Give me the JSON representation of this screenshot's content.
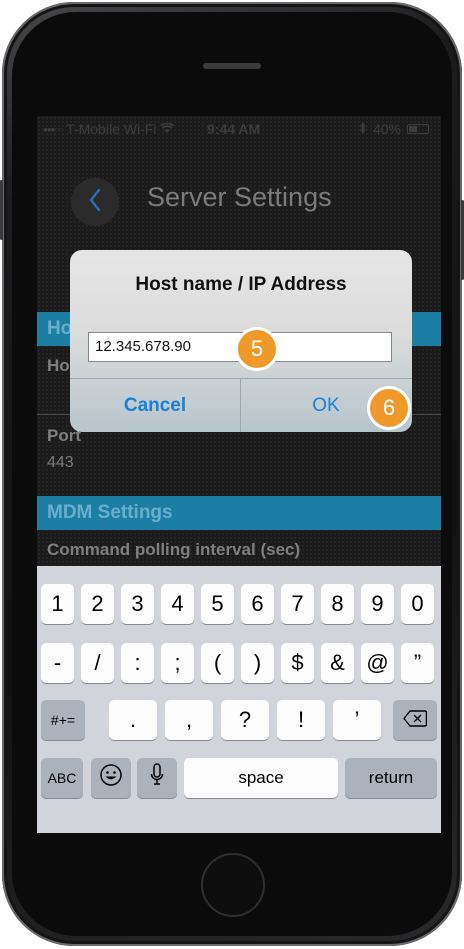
{
  "status_bar": {
    "carrier": "T-Mobile Wi-Fi",
    "time": "9:44 AM",
    "battery": "40%"
  },
  "nav": {
    "title": "Server Settings"
  },
  "sections": {
    "host_header": "Ho",
    "host_label": "Ho",
    "port_label": "Port",
    "port_value": "443",
    "mdm_header": "MDM Settings",
    "command_polling_label": "Command polling interval (sec)"
  },
  "dialog": {
    "title": "Host name / IP Address",
    "input_value": "12.345.678.90",
    "cancel_label": "Cancel",
    "ok_label": "OK"
  },
  "annotations": {
    "step_input": "5",
    "step_ok": "6"
  },
  "keyboard": {
    "row1": [
      "1",
      "2",
      "3",
      "4",
      "5",
      "6",
      "7",
      "8",
      "9",
      "0"
    ],
    "row2": [
      "-",
      "/",
      ":",
      ";",
      "(",
      ")",
      "$",
      "&",
      "@",
      "”"
    ],
    "row3_left": "#+=",
    "row3": [
      ".",
      ",",
      "?",
      "!",
      "’"
    ],
    "abc_label": "ABC",
    "space_label": "space",
    "return_label": "return"
  },
  "colors": {
    "section_header": "#1d7ea3",
    "accent_blue": "#1a7fd8",
    "badge_orange": "#f0992b"
  },
  "icons": {
    "back": "chevron-left-icon",
    "wifi": "wifi-icon",
    "bluetooth": "bluetooth-icon",
    "battery": "battery-icon",
    "delete": "backspace-icon",
    "emoji": "emoji-icon",
    "mic": "microphone-icon"
  }
}
